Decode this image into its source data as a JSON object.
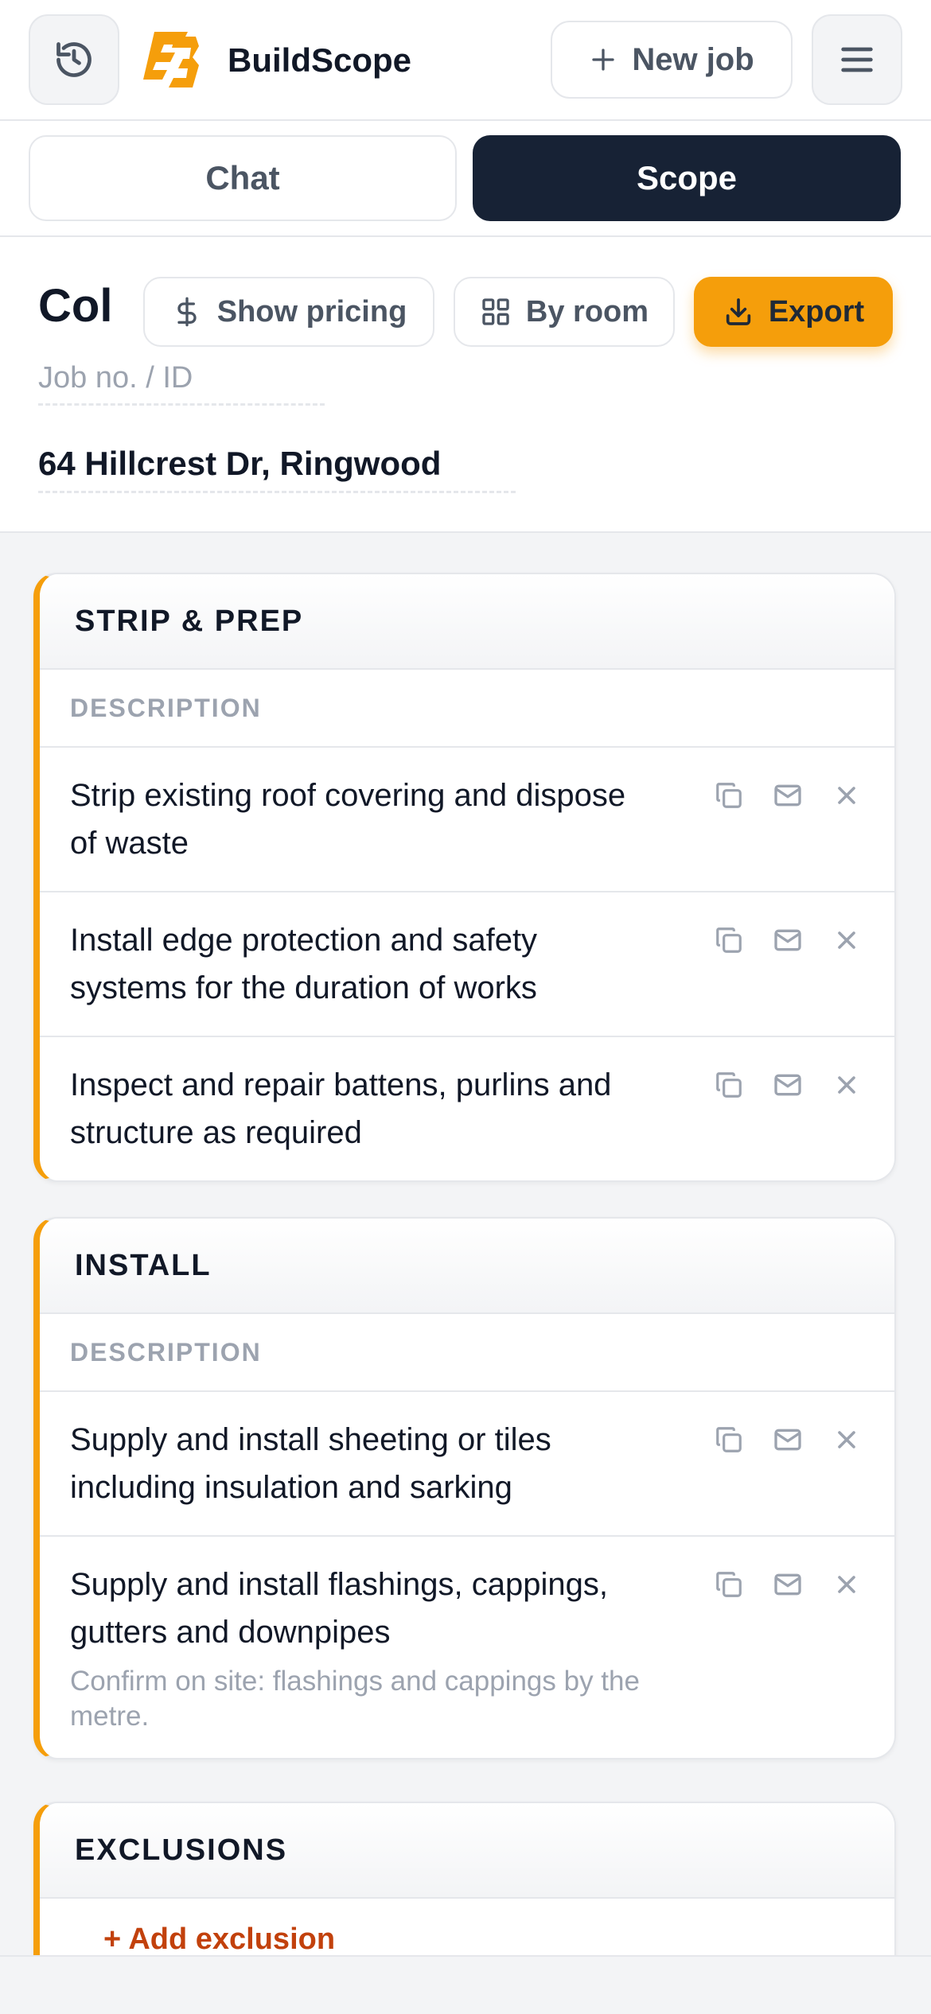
{
  "app": {
    "brand": "BuildScope",
    "new_job_label": "New job",
    "accent": "#f59e0b",
    "dark": "#172235"
  },
  "tabs": [
    {
      "label": "Chat",
      "active": false
    },
    {
      "label": "Scope",
      "active": true
    }
  ],
  "header": {
    "title": "Col",
    "show_pricing_label": "Show pricing",
    "by_room_label": "By room",
    "export_label": "Export",
    "job_no_placeholder": "Job no. / ID",
    "address": "64 Hillcrest Dr, Ringwood"
  },
  "sections": [
    {
      "title": "STRIP & PREP",
      "column": "DESCRIPTION",
      "items": [
        {
          "text": "Strip existing roof covering and dispose of waste"
        },
        {
          "text": "Install edge protection and safety systems for the duration of works"
        },
        {
          "text": "Inspect and repair battens, purlins and structure as required"
        }
      ]
    },
    {
      "title": "INSTALL",
      "column": "DESCRIPTION",
      "items": [
        {
          "text": "Supply and install sheeting or tiles including insulation and sarking"
        },
        {
          "text": "Supply and install flashings, cappings, gutters and downpipes",
          "note": "Confirm on site: flashings and cappings by the metre."
        }
      ]
    },
    {
      "title": "EXCLUSIONS",
      "add_label": "+ Add exclusion"
    }
  ],
  "icons": {
    "history": "history-icon",
    "menu": "hamburger-menu-icon",
    "plus": "plus-icon",
    "dollar": "dollar-icon",
    "grid": "grid-icon",
    "download": "download-icon",
    "copy": "copy-icon",
    "mail": "mail-icon",
    "close": "close-icon"
  }
}
